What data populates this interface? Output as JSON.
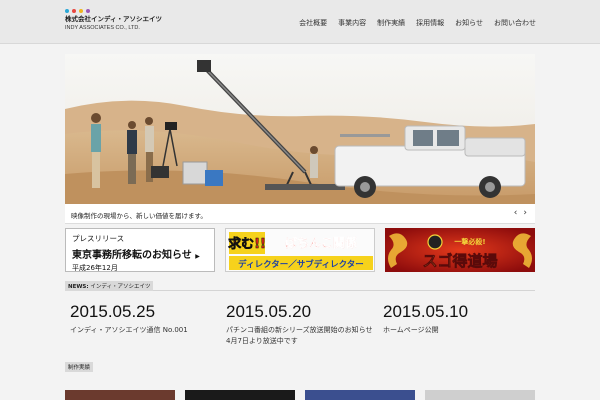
{
  "header": {
    "company_name": "株式会社インディ・アソシエイツ",
    "company_name_en": "INDY ASSOCIATES CO., LTD.",
    "logo_dot_colors": [
      "#2aa7d6",
      "#e8463f",
      "#f1b520",
      "#9b59b6"
    ],
    "nav": [
      "会社概要",
      "事業内容",
      "制作実績",
      "採用情報",
      "お知らせ",
      "お問い合わせ"
    ]
  },
  "slider": {
    "caption": "映像制作の現場から、新しい価値を届けます。",
    "prev_icon": "‹",
    "next_icon": "›"
  },
  "banners": {
    "press": {
      "line1": "プレスリリース",
      "line2": "東京事務所移転のお知らせ",
      "arrow": "▶",
      "line3": "平成26年12月"
    },
    "recruit": {
      "headline": "求む!!",
      "sub": "ぱちんこ関係",
      "line": "ディレクター／サブディレクター"
    },
    "show": {
      "small": "一撃必殺!",
      "title": "スゴ得道場"
    }
  },
  "news": {
    "label_en": "NEWS:",
    "label_jp": "インディ・アソシエイツ",
    "items": [
      {
        "date": "2015.05.25",
        "title": "インディ・アソシエイツ通信 No.001"
      },
      {
        "date": "2015.05.20",
        "title": "パチンコ番組の新シリーズ放送開始のお知らせ4月7日より放送中です"
      },
      {
        "date": "2015.05.10",
        "title": "ホームページ公開"
      }
    ]
  },
  "works": {
    "label": "制作実績"
  },
  "colors": {
    "header_bg": "#e9e9e9",
    "page_bg": "#f3f3f3",
    "recruit_red": "#e8261c",
    "recruit_blue": "#1b3fa6",
    "show_red": "#c81414",
    "show_gold": "#f3d43a"
  }
}
